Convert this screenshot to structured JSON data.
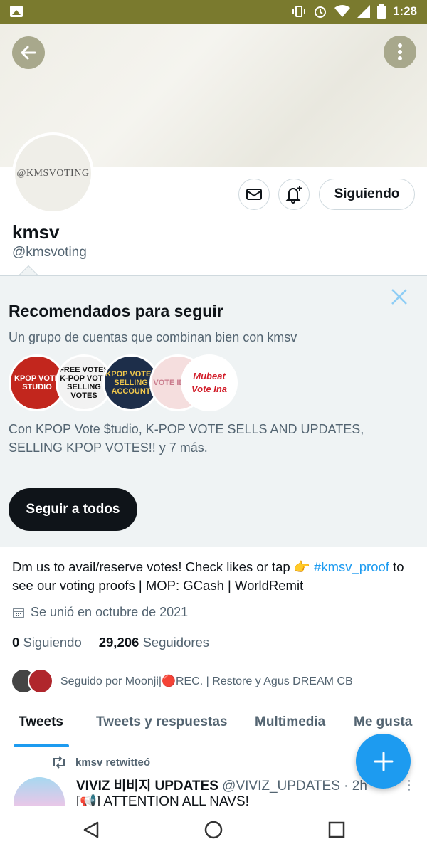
{
  "status_bar": {
    "time": "1:28"
  },
  "avatar": {
    "text": "@KMSVOTING"
  },
  "profile": {
    "name": "kmsv",
    "handle": "@kmsvoting",
    "follow_label": "Siguiendo"
  },
  "recommendations": {
    "title": "Recomendados para seguir",
    "subtitle": "Un grupo de cuentas que combinan bien con kmsv",
    "avatars": [
      {
        "text": "KPOP VOTE STUDIO"
      },
      {
        "text": "FREE VOTES K-POP VOTE SELLING VOTES"
      },
      {
        "text": "KPOP VOTES SELLING ACCOUNT"
      },
      {
        "text": "VOTE IDOL'S"
      },
      {
        "text": "Mubeat Vote Ina"
      }
    ],
    "description": "Con KPOP Vote $tudio, K-POP VOTE SELLS AND UPDATES, SELLING KPOP VOTES!! y 7 más.",
    "follow_all_label": "Seguir a todos"
  },
  "bio": {
    "part1": "Dm us to avail/reserve votes! Check likes or tap 👉 ",
    "hashtag": "#kmsv_proof",
    "part2": " to see our voting proofs | MOP: GCash | WorldRemit"
  },
  "joined": "Se unió en octubre de 2021",
  "counts": {
    "following_num": "0",
    "following_label": "Siguiendo",
    "followers_num": "29,206",
    "followers_label": "Seguidores"
  },
  "followed_by": "Seguido por Moonji|🔴REC. | Restore y Agus DREAM CB",
  "tabs": [
    {
      "label": "Tweets"
    },
    {
      "label": "Tweets y respuestas"
    },
    {
      "label": "Multimedia"
    },
    {
      "label": "Me gusta"
    }
  ],
  "tweet": {
    "retweet_label": "kmsv retwitteó",
    "author_name": "VIVIZ 비비지 UPDATES",
    "author_handle": "@VIVIZ_UPDATES",
    "time": "· 2h",
    "text": "[📢] ATTENTION ALL NAVS!"
  },
  "colors": {
    "accent": "#1d9bf0",
    "status_bar": "#7a7a2e",
    "text": "#0f1419",
    "muted": "#536471"
  }
}
